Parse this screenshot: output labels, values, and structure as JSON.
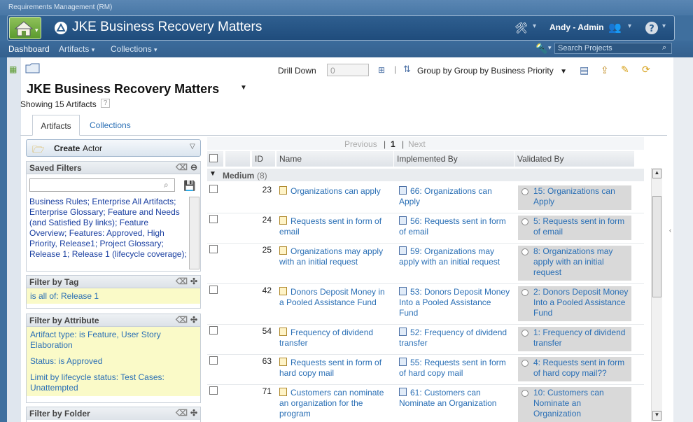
{
  "window": {
    "title": "Requirements Management (RM)"
  },
  "header": {
    "project": "JKE Business Recovery Matters",
    "user": "Andy - Admin"
  },
  "nav": {
    "dashboard": "Dashboard",
    "artifacts": "Artifacts",
    "collections": "Collections",
    "search_placeholder": "Search Projects"
  },
  "toolbar": {
    "drill_down_label": "Drill Down",
    "drill_down_value": "0",
    "group_by": "Group by Group by Business Priority"
  },
  "page": {
    "title": "JKE Business Recovery Matters",
    "showing": "Showing 15 Artifacts",
    "help": "?"
  },
  "tabs": [
    "Artifacts",
    "Collections"
  ],
  "create": {
    "label": "Create",
    "type": "Actor"
  },
  "saved_filters": {
    "title": "Saved Filters",
    "items": [
      "Business Rules",
      "Enterprise All Artifacts",
      "Enterprise Glossary",
      "Feature and Needs (and Satisfied By links)",
      "Feature Overview",
      "Features: Approved, High Priority, Release1",
      "Project Glossary",
      "Release 1",
      "Release 1 (lifecycle coverage)"
    ]
  },
  "filter_tag": {
    "title": "Filter by Tag",
    "value": "is all of: Release 1"
  },
  "filter_attribute": {
    "title": "Filter by Attribute",
    "values": [
      "Artifact type: is Feature, User Story Elaboration",
      "Status: is Approved",
      "Limit by lifecycle status: Test Cases: Unattempted"
    ]
  },
  "filter_folder": {
    "title": "Filter by Folder"
  },
  "pager": {
    "previous": "Previous",
    "current": "1",
    "next": "Next"
  },
  "columns": {
    "id": "ID",
    "name": "Name",
    "implemented": "Implemented By",
    "validated": "Validated By"
  },
  "group": {
    "name": "Medium",
    "count": "(8)"
  },
  "rows": [
    {
      "id": "23",
      "name": "Organizations can apply",
      "impl": "66: Organizations can Apply",
      "val": "15: Organizations can Apply"
    },
    {
      "id": "24",
      "name": "Requests sent in form of email",
      "impl": "56: Requests sent in form of email",
      "val": "5: Requests sent in form of email"
    },
    {
      "id": "25",
      "name": "Organizations may apply with an initial request",
      "impl": "59: Organizations may apply with an initial request",
      "val": "8: Organizations may apply with an initial request"
    },
    {
      "id": "42",
      "name": "Donors Deposit Money in a Pooled Assistance Fund",
      "impl": "53: Donors Deposit Money Into a Pooled Assistance Fund",
      "val": "2: Donors Deposit Money Into a Pooled Assistance Fund"
    },
    {
      "id": "54",
      "name": "Frequency of dividend transfer",
      "impl": "52: Frequency of dividend transfer",
      "val": "1: Frequency of dividend transfer"
    },
    {
      "id": "63",
      "name": "Requests sent in form of hard copy mail",
      "impl": "55: Requests sent in form of hard copy mail",
      "val": "4: Requests sent in form of hard copy mail??"
    },
    {
      "id": "71",
      "name": "Customers can nominate an organization for the program",
      "impl": "61: Customers can Nominate an Organization",
      "val": "10: Customers can Nominate an Organization"
    }
  ]
}
